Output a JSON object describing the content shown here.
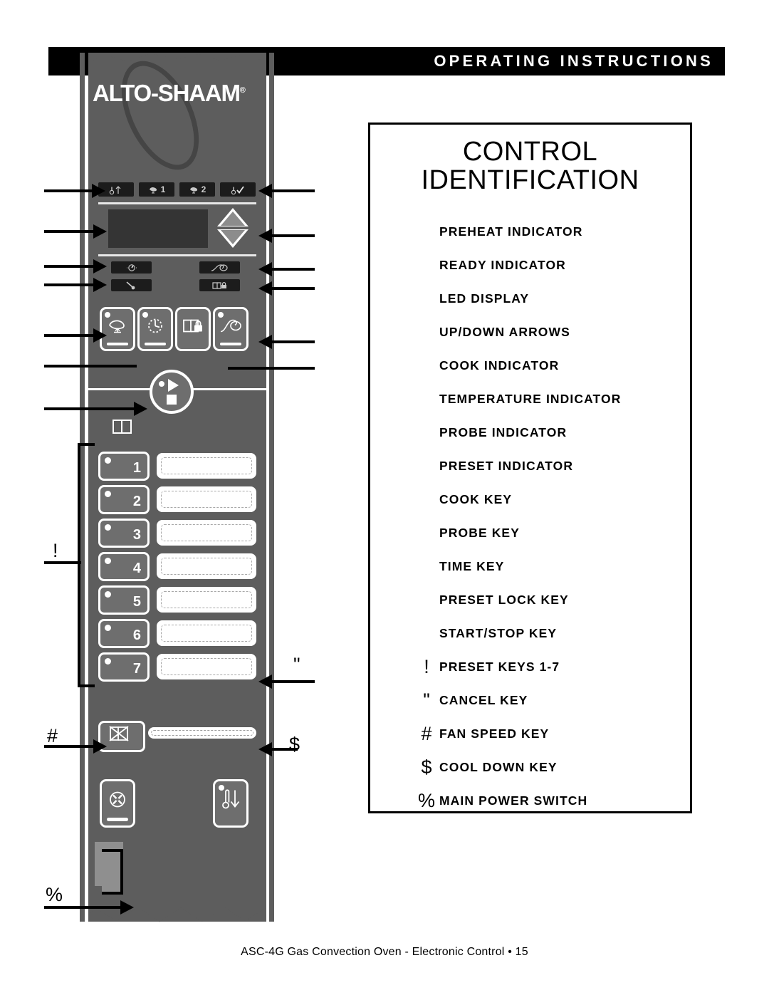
{
  "header": {
    "title": "OPERATING INSTRUCTIONS",
    "brand": "ALTO-SHAAM",
    "brand_mark": "®"
  },
  "identification": {
    "title_line1": "CONTROL",
    "title_line2": "IDENTIFICATION",
    "items": [
      {
        "symbol": "",
        "label": "PREHEAT INDICATOR"
      },
      {
        "symbol": "",
        "label": "READY INDICATOR"
      },
      {
        "symbol": "",
        "label": "LED DISPLAY"
      },
      {
        "symbol": "",
        "label": "UP/DOWN ARROWS"
      },
      {
        "symbol": "",
        "label": "COOK INDICATOR"
      },
      {
        "symbol": "",
        "label": "TEMPERATURE INDICATOR"
      },
      {
        "symbol": "",
        "label": "PROBE INDICATOR"
      },
      {
        "symbol": "",
        "label": "PRESET INDICATOR"
      },
      {
        "symbol": "",
        "label": "COOK KEY"
      },
      {
        "symbol": "",
        "label": "PROBE KEY"
      },
      {
        "symbol": "",
        "label": "TIME KEY"
      },
      {
        "symbol": "",
        "label": "PRESET LOCK KEY"
      },
      {
        "symbol": "",
        "label": "START/STOP KEY"
      },
      {
        "symbol": "!",
        "label": "PRESET KEYS 1-7"
      },
      {
        "symbol": "\"",
        "label": "CANCEL KEY"
      },
      {
        "symbol": "#",
        "label": "FAN SPEED KEY"
      },
      {
        "symbol": "$",
        "label": "COOL DOWN KEY"
      },
      {
        "symbol": "%",
        "label": "MAIN POWER SWITCH"
      }
    ]
  },
  "panel": {
    "indicators": [
      {
        "name": "preheat-indicator",
        "text": ""
      },
      {
        "name": "cook-indicator-1",
        "text": "1"
      },
      {
        "name": "cook-indicator-2",
        "text": "2"
      },
      {
        "name": "ready-indicator",
        "text": ""
      }
    ],
    "status_indicators": [
      {
        "name": "cook-indicator"
      },
      {
        "name": "temperature-indicator"
      },
      {
        "name": "probe-indicator"
      },
      {
        "name": "preset-indicator"
      }
    ],
    "mode_keys": [
      {
        "name": "cook-key"
      },
      {
        "name": "time-key"
      },
      {
        "name": "preset-lock-key"
      },
      {
        "name": "probe-key"
      }
    ],
    "preset_keys": [
      "1",
      "2",
      "3",
      "4",
      "5",
      "6",
      "7"
    ],
    "bottom_keys": [
      {
        "name": "fan-speed-key"
      },
      {
        "name": "cool-down-key"
      }
    ]
  },
  "callout_markers": {
    "preset_keys": "!",
    "cancel_key": "\"",
    "fan_speed_key": "#",
    "cool_down_key": "$",
    "main_power_switch": "%"
  },
  "footer": {
    "text": "ASC-4G Gas Convection Oven - Electronic Control • 15"
  },
  "colors": {
    "panel": "#5d5d5d",
    "key": "#6e6e6e",
    "indicator": "#1c1c1c",
    "display": "#343434",
    "header_bar": "#000000",
    "white": "#ffffff"
  }
}
